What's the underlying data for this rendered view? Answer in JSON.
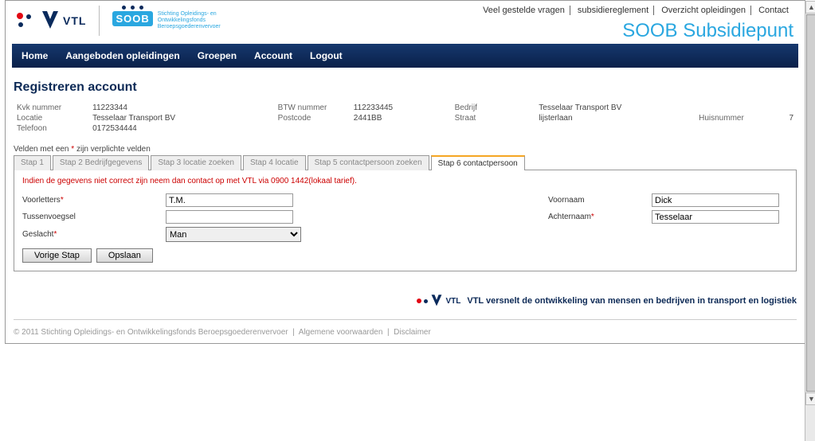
{
  "topnav": {
    "faq": "Veel gestelde vragen",
    "subsidy_rules": "subsidiereglement",
    "trainings_overview": "Overzicht opleidingen",
    "contact": "Contact"
  },
  "brand_title": "SOOB Subsidiepunt",
  "logos": {
    "vtl_text": "VTL",
    "soob_text": "SOOB",
    "soob_sub": "Stichting Opleidings- en Ontwikkelingsfonds Beroepsgoederenvervoer"
  },
  "menu": {
    "home": "Home",
    "aangeboden": "Aangeboden opleidingen",
    "groepen": "Groepen",
    "account": "Account",
    "logout": "Logout"
  },
  "page_title": "Registreren account",
  "summary": {
    "kvk_label": "Kvk nummer",
    "kvk": "11223344",
    "locatie_label": "Locatie",
    "locatie": "Tesselaar Transport BV",
    "telefoon_label": "Telefoon",
    "telefoon": "0172534444",
    "btw_label": "BTW nummer",
    "btw": "112233445",
    "postcode_label": "Postcode",
    "postcode": "2441BB",
    "bedrijf_label": "Bedrijf",
    "bedrijf": "Tesselaar Transport BV",
    "straat_label": "Straat",
    "straat": "lijsterlaan",
    "huisnummer_label": "Huisnummer",
    "huisnummer": "7"
  },
  "required_note_prefix": "Velden met een ",
  "required_note_suffix": " zijn verplichte velden",
  "tabs": {
    "stap1": "Stap 1",
    "stap2": "Stap 2 Bedrijfgegevens",
    "stap3": "Stap 3 locatie zoeken",
    "stap4": "Stap 4 locatie",
    "stap5": "Stap 5 contactpersoon zoeken",
    "stap6": "Stap 6 contactpersoon"
  },
  "alert_text": "Indien de gegevens niet correct zijn neem dan contact op met VTL via 0900 1442(lokaal tarief).",
  "form": {
    "voorletters_label": "Voorletters",
    "voorletters_value": "T.M.",
    "tussenvoegsel_label": "Tussenvoegsel",
    "tussenvoegsel_value": "",
    "geslacht_label": "Geslacht",
    "geslacht_value": "Man",
    "voornaam_label": "Voornaam",
    "voornaam_value": "Dick",
    "achternaam_label": "Achternaam",
    "achternaam_value": "Tesselaar"
  },
  "buttons": {
    "prev": "Vorige Stap",
    "save": "Opslaan"
  },
  "footer_banner_text": "VTL versnelt de ontwikkeling van mensen en bedrijven in transport en logistiek",
  "footer_line": {
    "copyright": "© 2011 Stichting Opleidings- en Ontwikkelingsfonds Beroepsgoederenvervoer",
    "algemene": "Algemene voorwaarden",
    "disclaimer": "Disclaimer"
  }
}
